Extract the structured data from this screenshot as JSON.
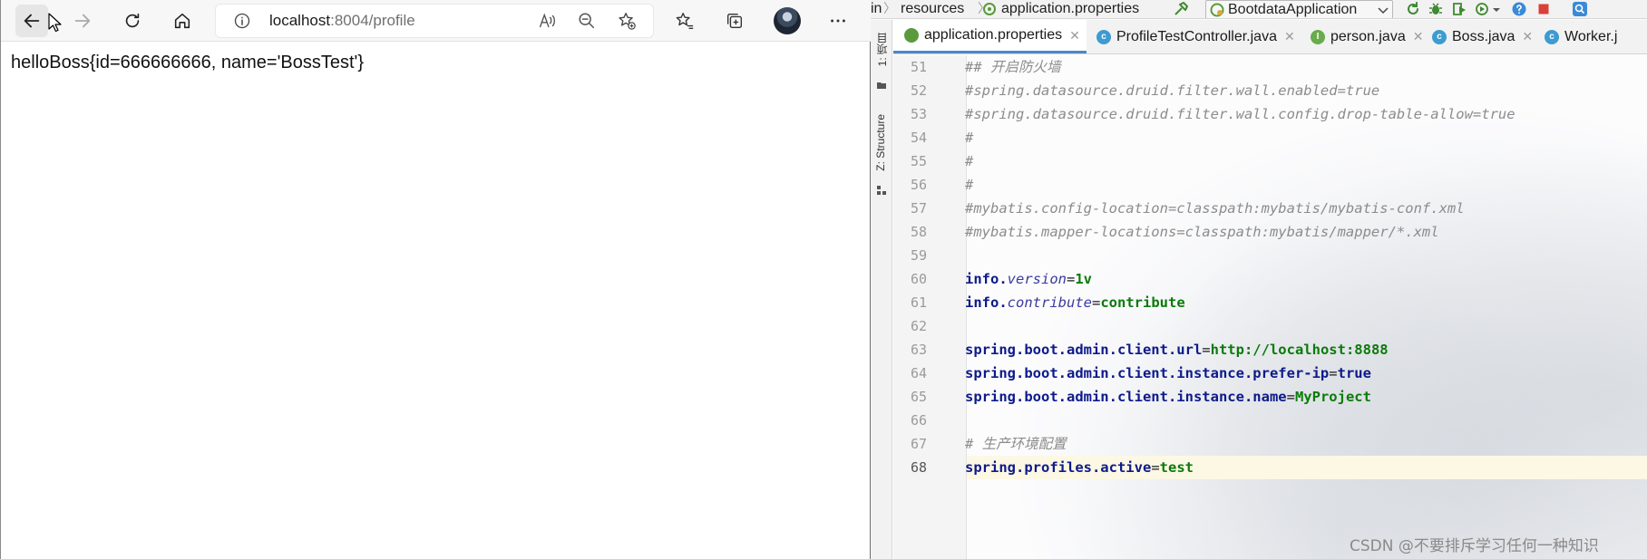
{
  "browser": {
    "url_host": "localhost",
    "url_rest": ":8004/profile",
    "page_text": "helloBoss{id=666666666, name='BossTest'}"
  },
  "ide": {
    "breadcrumbs": [
      "in",
      "resources",
      "application.properties"
    ],
    "run_config": "BootdataApplication",
    "tool_windows": [
      "1: 项目",
      "Z: Structure"
    ],
    "tabs": [
      {
        "label": "application.properties",
        "icon": "properties-icon",
        "active": true
      },
      {
        "label": "ProfileTestController.java",
        "icon": "class-icon",
        "active": false
      },
      {
        "label": "person.java",
        "icon": "interface-icon",
        "active": false
      },
      {
        "label": "Boss.java",
        "icon": "class-icon",
        "active": false
      },
      {
        "label": "Worker.j",
        "icon": "class-icon",
        "active": false
      }
    ],
    "current_line": 68,
    "lines": [
      {
        "n": "51",
        "parts": [
          {
            "t": "## 开启防火墙",
            "c": "comment"
          }
        ]
      },
      {
        "n": "52",
        "parts": [
          {
            "t": "#spring.datasource.druid.filter.wall.enabled=true",
            "c": "comment"
          }
        ]
      },
      {
        "n": "53",
        "parts": [
          {
            "t": "#spring.datasource.druid.filter.wall.config.drop-table-allow=true",
            "c": "comment"
          }
        ]
      },
      {
        "n": "54",
        "parts": [
          {
            "t": "#",
            "c": "comment"
          }
        ]
      },
      {
        "n": "55",
        "parts": [
          {
            "t": "#",
            "c": "comment"
          }
        ]
      },
      {
        "n": "56",
        "parts": [
          {
            "t": "#",
            "c": "comment"
          }
        ]
      },
      {
        "n": "57",
        "parts": [
          {
            "t": "#mybatis.config-location=classpath:mybatis/mybatis-conf.xml",
            "c": "comment"
          }
        ]
      },
      {
        "n": "58",
        "parts": [
          {
            "t": "#mybatis.mapper-locations=classpath:mybatis/mapper/*.xml",
            "c": "comment"
          }
        ]
      },
      {
        "n": "59",
        "parts": []
      },
      {
        "n": "60",
        "parts": [
          {
            "t": "info.",
            "c": "key"
          },
          {
            "t": "version",
            "c": "sub"
          },
          {
            "t": "=",
            "c": "eq"
          },
          {
            "t": "1v",
            "c": "val"
          }
        ]
      },
      {
        "n": "61",
        "parts": [
          {
            "t": "info.",
            "c": "key"
          },
          {
            "t": "contribute",
            "c": "sub"
          },
          {
            "t": "=",
            "c": "eq"
          },
          {
            "t": "contribute",
            "c": "val"
          }
        ]
      },
      {
        "n": "62",
        "parts": []
      },
      {
        "n": "63",
        "parts": [
          {
            "t": "spring.boot.admin.client.url",
            "c": "key"
          },
          {
            "t": "=",
            "c": "eq"
          },
          {
            "t": "http://localhost:8888",
            "c": "val"
          }
        ]
      },
      {
        "n": "64",
        "parts": [
          {
            "t": "spring.boot.admin.client.instance.prefer-ip",
            "c": "key"
          },
          {
            "t": "=",
            "c": "eq"
          },
          {
            "t": "true",
            "c": "key"
          }
        ]
      },
      {
        "n": "65",
        "parts": [
          {
            "t": "spring.boot.admin.client.instance.name",
            "c": "key"
          },
          {
            "t": "=",
            "c": "eq"
          },
          {
            "t": "MyProject",
            "c": "val"
          }
        ]
      },
      {
        "n": "66",
        "parts": []
      },
      {
        "n": "67",
        "parts": [
          {
            "t": "# 生产环境配置",
            "c": "comment"
          }
        ]
      },
      {
        "n": "68",
        "parts": [
          {
            "t": "spring.profiles.active",
            "c": "key"
          },
          {
            "t": "=",
            "c": "eq"
          },
          {
            "t": "test",
            "c": "val"
          }
        ]
      }
    ]
  },
  "watermark": "CSDN @不要排斥学习任何一种知识",
  "colors": {
    "accent": "#4a88c7",
    "key": "#0d1a8a",
    "value": "#0b7a0b",
    "comment": "#8c8c8c"
  }
}
